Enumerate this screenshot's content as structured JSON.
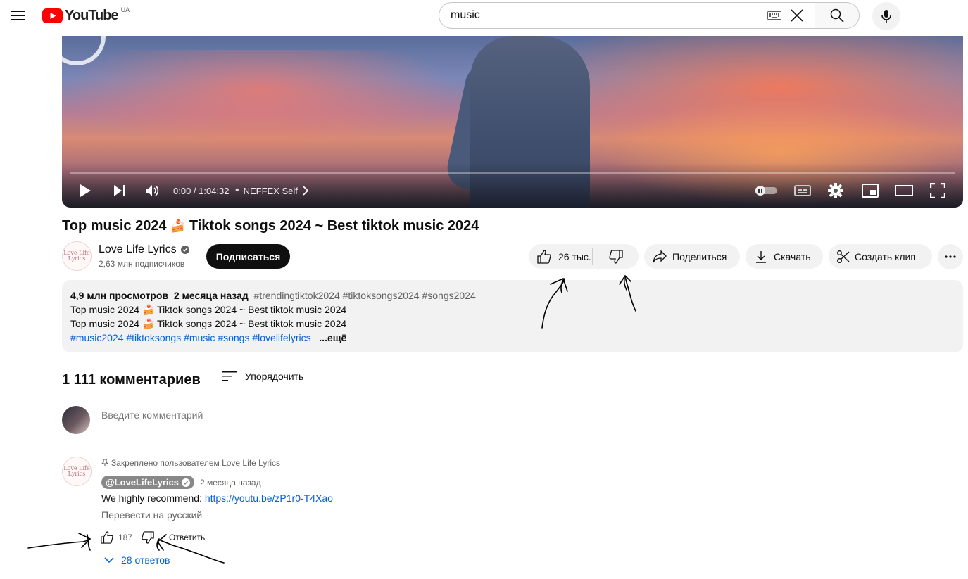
{
  "header": {
    "logo_text": "YouTube",
    "country_code": "UA",
    "search_value": "music"
  },
  "player": {
    "time": "0:00 / 1:04:32",
    "chapter": "NEFFEX Self"
  },
  "video": {
    "title_part1": "Top music 2024",
    "title_part2": "Tiktok songs 2024 ~ Best tiktok music 2024",
    "channel_name": "Love Life Lyrics",
    "avatar_text": "Love Life Lyrics",
    "subscribers": "2,63 млн подписчиков",
    "subscribe_label": "Подписаться",
    "likes": "26 тыс.",
    "share_label": "Поделиться",
    "download_label": "Скачать",
    "clip_label": "Создать клип"
  },
  "description": {
    "views": "4,9 млн просмотров",
    "date": "2 месяца назад",
    "tags": "#trendingtiktok2024 #tiktoksongs2024 #songs2024",
    "line1_a": "Top music 2024",
    "line1_b": "Tiktok songs 2024 ~ Best tiktok music 2024",
    "line2_a": "Top music 2024",
    "line2_b": "Tiktok songs 2024 ~ Best tiktok music 2024",
    "hashtags": "#music2024 #tiktoksongs #music #songs #lovelifelyrics",
    "more_label": "...ещё"
  },
  "comments": {
    "count_label": "1 111 комментариев",
    "sort_label": "Упорядочить",
    "add_placeholder": "Введите комментарий",
    "items": [
      {
        "pinned_label": "Закреплено пользователем Love Life Lyrics",
        "author": "@LoveLifeLyrics",
        "time": "2 месяца назад",
        "text_prefix": "We highly recommend: ",
        "link": "https://youtu.be/zP1r0-T4Xao",
        "translate_label": "Перевести на русский",
        "likes": "187",
        "reply_label": "Ответить",
        "replies_label": "28 ответов"
      }
    ]
  },
  "colors": {
    "accent_red": "#ff0000",
    "link_blue": "#065fd4",
    "chip_bg": "#f2f2f2"
  }
}
